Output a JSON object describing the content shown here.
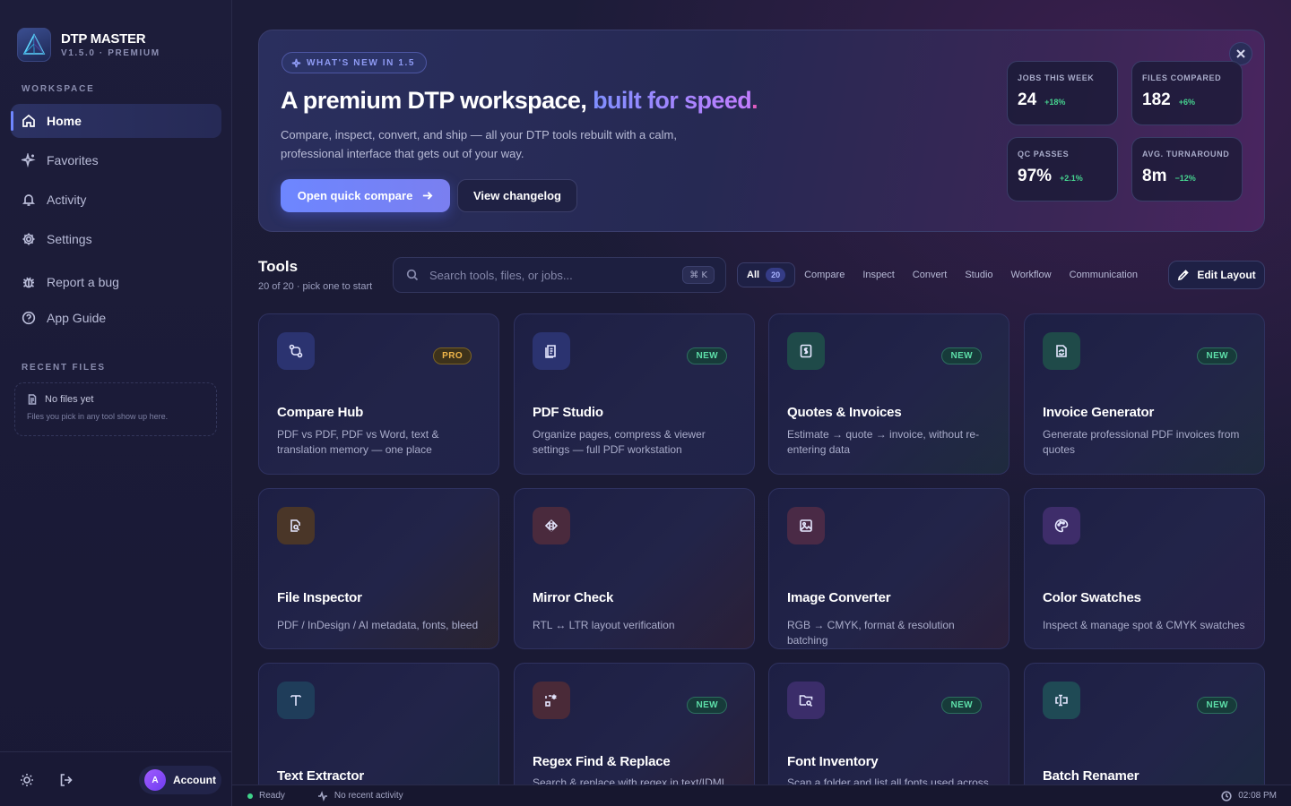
{
  "brand": {
    "name": "DTP MASTER",
    "version": "V1.5.0 · PREMIUM"
  },
  "sidebar": {
    "workspace_label": "WORKSPACE",
    "items": [
      {
        "label": "Home",
        "icon": "home-icon",
        "active": true
      },
      {
        "label": "Favorites",
        "icon": "sparkle-icon"
      },
      {
        "label": "Activity",
        "icon": "bell-icon"
      },
      {
        "label": "Settings",
        "icon": "gear-icon"
      },
      {
        "label": "Report a bug",
        "icon": "bug-icon"
      },
      {
        "label": "App Guide",
        "icon": "help-circle-icon"
      }
    ],
    "recent_label": "RECENT FILES",
    "recent_empty_title": "No files yet",
    "recent_empty_hint": "Files you pick in any tool show up here.",
    "account": {
      "initial": "A",
      "label": "Account"
    }
  },
  "hero": {
    "pill": "WHAT'S NEW IN 1.5",
    "title_start": "A premium DTP workspace, ",
    "title_accent": "built for speed",
    "title_end": ".",
    "description": "Compare, inspect, convert, and ship — all your DTP tools rebuilt with a calm, professional interface that gets out of your way.",
    "primary_cta": "Open quick compare",
    "secondary_cta": "View changelog",
    "stats": [
      {
        "label": "JOBS THIS WEEK",
        "value": "24",
        "delta": "+18%"
      },
      {
        "label": "FILES COMPARED",
        "value": "182",
        "delta": "+6%"
      },
      {
        "label": "QC PASSES",
        "value": "97%",
        "delta": "+2.1%"
      },
      {
        "label": "AVG. TURNAROUND",
        "value": "8m",
        "delta": "−12%"
      }
    ]
  },
  "tools": {
    "title": "Tools",
    "subtitle": "20 of 20 · pick one to start",
    "search_placeholder": "Search tools, files, or jobs...",
    "search_shortcut": "⌘ K",
    "filters": [
      {
        "label": "All",
        "count": "20",
        "active": true
      },
      {
        "label": "Compare"
      },
      {
        "label": "Inspect"
      },
      {
        "label": "Convert"
      },
      {
        "label": "Studio"
      },
      {
        "label": "Workflow"
      },
      {
        "label": "Communication"
      }
    ],
    "edit_layout": "Edit Layout",
    "cards": [
      {
        "title": "Compare Hub",
        "desc": "PDF vs PDF, PDF vs Word, text & translation memory — one place",
        "badge": "PRO",
        "icon": "compare-icon",
        "color": "#2b3370"
      },
      {
        "title": "PDF Studio",
        "desc": "Organize pages, compress & viewer settings — full PDF workstation",
        "badge": "NEW",
        "icon": "document-stack-icon",
        "color": "#2b3370"
      },
      {
        "title": "Quotes & Invoices",
        "desc": "Estimate → quote → invoice, without re-entering data",
        "badge": "NEW",
        "icon": "dollar-document-icon",
        "color": "#1f4a49"
      },
      {
        "title": "Invoice Generator",
        "desc": "Generate professional PDF invoices from quotes",
        "badge": "NEW",
        "icon": "refresh-document-icon",
        "color": "#1f4a49"
      },
      {
        "title": "File Inspector",
        "desc": "PDF / InDesign / AI metadata, fonts, bleed",
        "badge": "",
        "icon": "file-search-icon",
        "color": "#4a3628"
      },
      {
        "title": "Mirror Check",
        "desc": "RTL ↔ LTR layout verification",
        "badge": "",
        "icon": "mirror-icon",
        "color": "#4a2a3d"
      },
      {
        "title": "Image Converter",
        "desc": "RGB → CMYK, format & resolution batching",
        "badge": "",
        "icon": "image-icon",
        "color": "#4a2a46"
      },
      {
        "title": "Color Swatches",
        "desc": "Inspect & manage spot & CMYK swatches",
        "badge": "",
        "icon": "palette-icon",
        "color": "#3e2d6a"
      },
      {
        "title": "Text Extractor",
        "desc": "",
        "badge": "",
        "icon": "text-icon",
        "color": "#1f3d5a"
      },
      {
        "title": "Regex Find & Replace",
        "desc": "Search & replace with regex in text/IDML",
        "badge": "NEW",
        "icon": "regex-icon",
        "color": "#4a2a38"
      },
      {
        "title": "Font Inventory",
        "desc": "Scan a folder and list all fonts used across",
        "badge": "NEW",
        "icon": "folder-search-icon",
        "color": "#3b2d6a"
      },
      {
        "title": "Batch Renamer",
        "desc": "",
        "badge": "NEW",
        "icon": "rename-icon",
        "color": "#1f4a55"
      }
    ]
  },
  "statusbar": {
    "state": "Ready",
    "activity": "No recent activity",
    "time": "02:08 PM"
  }
}
